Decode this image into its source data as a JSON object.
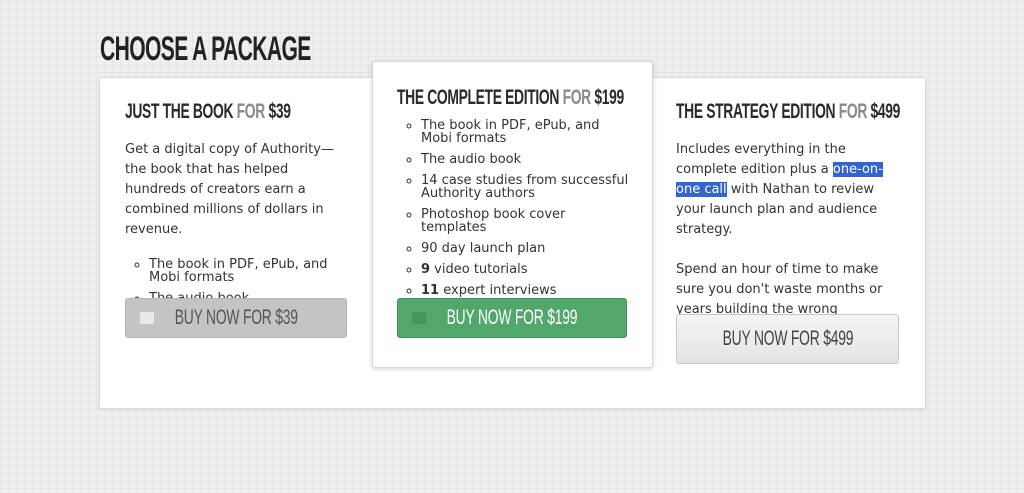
{
  "page_title": "CHOOSE A PACKAGE",
  "packages": [
    {
      "name": "JUST THE BOOK",
      "for_word": "FOR",
      "price": "$39",
      "description": "Get a digital copy of Authority—the book that has helped hundreds of creators earn a combined millions of dollars in revenue.",
      "features": [
        "The book in PDF, ePub, and Mobi formats",
        "The audio book"
      ],
      "button_label": "BUY NOW FOR $39"
    },
    {
      "name": "THE COMPLETE EDITION",
      "for_word": "FOR",
      "price": "$199",
      "features": [
        "The book in PDF, ePub, and Mobi formats",
        "The audio book",
        "14 case studies from successful Authority authors",
        "Photoshop book cover templates",
        "90 day launch plan",
        {
          "bold": "9",
          "text": " video tutorials"
        },
        {
          "bold": "11",
          "text": " expert interviews"
        }
      ],
      "button_label": "BUY NOW FOR $199"
    },
    {
      "name": "THE STRATEGY EDITION",
      "for_word": "FOR",
      "price": "$499",
      "description_before": "Includes everything in the complete edition plus a ",
      "description_highlight": "one-on-one call",
      "description_after": " with Nathan to review your launch plan and audience strategy.",
      "description_2": "Spend an hour of time to make sure you don't waste months or years building the wrong audience.",
      "button_label": "BUY NOW FOR $499"
    }
  ],
  "colors": {
    "accent_green": "#52a86a",
    "button_grey": "#c4c4c4",
    "selection_highlight": "#3264d6",
    "price_for_grey": "#8a8a8a"
  }
}
